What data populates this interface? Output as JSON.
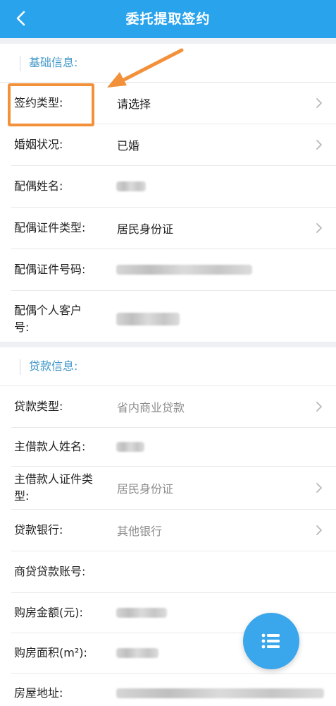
{
  "header": {
    "title": "委托提取签约"
  },
  "basic_section": {
    "title": "基础信息:",
    "rows": [
      {
        "label": "签约类型:",
        "value": "请选择"
      },
      {
        "label": "婚姻状况:",
        "value": "已婚"
      },
      {
        "label": "配偶姓名:",
        "value": ""
      },
      {
        "label": "配偶证件类型:",
        "value": "居民身份证"
      },
      {
        "label": "配偶证件号码:",
        "value": ""
      },
      {
        "label_line1": "配偶个人客户",
        "label_line2": "号:",
        "value": ""
      }
    ]
  },
  "loan_section": {
    "title": "贷款信息:",
    "rows": [
      {
        "label": "贷款类型:",
        "value": "省内商业贷款"
      },
      {
        "label": "主借款人姓名:",
        "value": ""
      },
      {
        "label_line1": "主借款人证件类",
        "label_line2": "型:",
        "value": "居民身份证"
      },
      {
        "label": "贷款银行:",
        "value": "其他银行"
      },
      {
        "label": "商贷贷款账号:",
        "value": ""
      },
      {
        "label": "购房金额(元):",
        "value": ""
      },
      {
        "label": "购房面积(m²):",
        "value": ""
      },
      {
        "label": "房屋地址:",
        "value": ""
      }
    ]
  },
  "icons": {
    "back": "chevron-left-icon",
    "row_arrow": "chevron-right-icon",
    "fab": "list-menu-icon"
  },
  "colors": {
    "header_bg": "#29a3ec",
    "section_title": "#3d96c8",
    "highlight": "#f2913a",
    "fab_bg": "#3aa6ec"
  }
}
